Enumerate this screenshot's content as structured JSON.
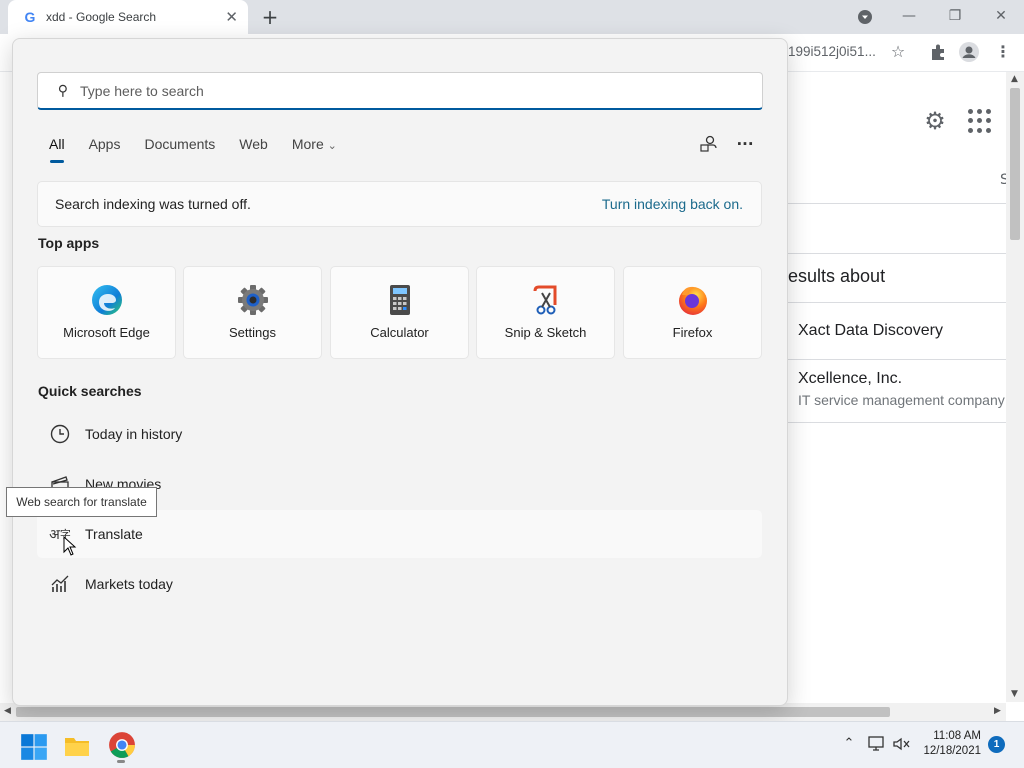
{
  "browser": {
    "tab_title": "xdd - Google Search",
    "tab_close": "✕",
    "new_tab": "+",
    "url_fragment": "199i512j0i51...",
    "window_minimize": "—",
    "window_restore": "❐",
    "window_close": "✕"
  },
  "google": {
    "results_about": "esults about",
    "right_fragment": "S",
    "knowledge_items": [
      {
        "title": "Xact Data Discovery",
        "subtitle": ""
      },
      {
        "title": "Xcellence, Inc.",
        "subtitle": "IT service management company"
      }
    ]
  },
  "search": {
    "placeholder": "Type here to search",
    "tabs": [
      {
        "label": "All",
        "active": true
      },
      {
        "label": "Apps",
        "active": false
      },
      {
        "label": "Documents",
        "active": false
      },
      {
        "label": "Web",
        "active": false
      },
      {
        "label": "More",
        "active": false
      }
    ],
    "more_chevron": "⌄",
    "options_label": "···",
    "notice": {
      "message": "Search indexing was turned off.",
      "link": "Turn indexing back on."
    },
    "top_apps_heading": "Top apps",
    "top_apps": [
      {
        "name": "Microsoft Edge",
        "icon": "edge-icon"
      },
      {
        "name": "Settings",
        "icon": "gear-icon"
      },
      {
        "name": "Calculator",
        "icon": "calculator-icon"
      },
      {
        "name": "Snip & Sketch",
        "icon": "snip-sketch-icon"
      },
      {
        "name": "Firefox",
        "icon": "firefox-icon"
      }
    ],
    "quick_searches_heading": "Quick searches",
    "quick_searches": [
      {
        "label": "Today in history",
        "icon": "clock-icon"
      },
      {
        "label": "New movies",
        "icon": "clapperboard-icon"
      },
      {
        "label": "Translate",
        "icon": "translate-icon"
      },
      {
        "label": "Markets today",
        "icon": "chart-icon"
      }
    ],
    "tooltip": "Web search for translate"
  },
  "taskbar": {
    "time": "11:08 AM",
    "date": "12/18/2021",
    "notification_count": "1",
    "apps": [
      "start-icon",
      "file-explorer-icon",
      "chrome-icon"
    ]
  },
  "colors": {
    "accent": "#005a9e",
    "link": "#1b6a8c",
    "badge": "#0f6cbd"
  }
}
